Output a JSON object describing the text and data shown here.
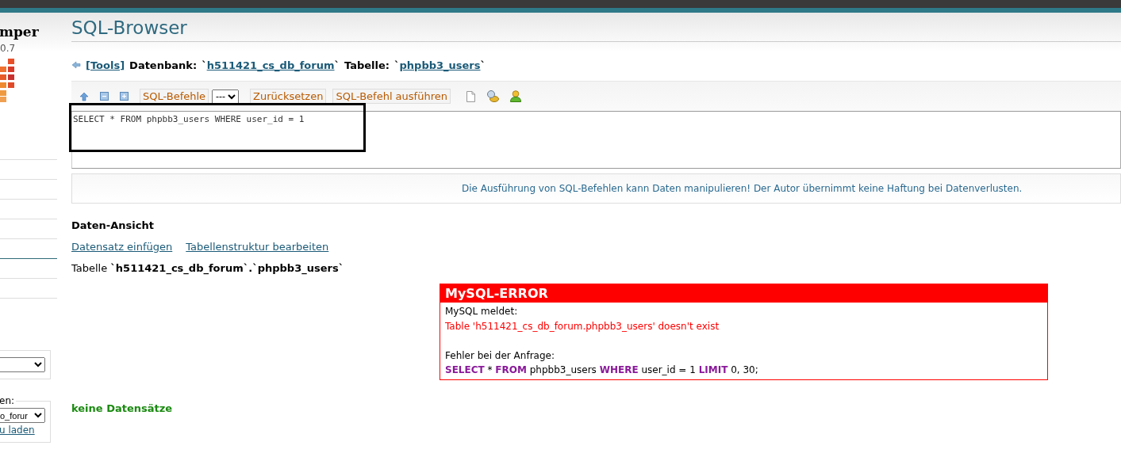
{
  "sidebar": {
    "logo_text": "mper",
    "version": "0.7",
    "fieldsets": [
      {
        "kind": "plain"
      },
      {
        "kind": "labeled",
        "legend": "en:",
        "select": "o_forur",
        "link": "u laden"
      }
    ]
  },
  "header": {
    "title": "SQL-Browser"
  },
  "breadcrumb": {
    "back": "[Tools]",
    "db_label": "Datenbank:",
    "db_open": "`",
    "db_name": "h511421_cs_db_forum",
    "db_close": "`",
    "table_label": "Tabelle:",
    "table_open": "`",
    "table_name": "phpbb3_users",
    "table_close": "`"
  },
  "toolbar": {
    "commands_label": "SQL-Befehle",
    "select": "---",
    "reset": "Zurücksetzen",
    "execute": "SQL-Befehl ausführen"
  },
  "editor": {
    "value": "SELECT * FROM phpbb3_users WHERE user_id = 1"
  },
  "notice": "Die Ausführung von SQL-Befehlen kann Daten manipulieren! Der Autor übernimmt keine Haftung bei Datenverlusten.",
  "data_view": {
    "heading": "Daten-Ansicht",
    "links": [
      "Datensatz einfügen",
      "Tabellenstruktur bearbeiten"
    ],
    "table_caption": "Tabelle **`h511421_cs_db_forum`.`phpbb3_users`**"
  },
  "error": {
    "title": "MySQL-ERROR",
    "reporter": "MySQL meldet:",
    "message": "Table 'h511421_cs_db_forum.phpbb3_users' doesn't exist",
    "query_label": "Fehler bei der Anfrage:",
    "query": [
      {
        "kind": "keyword",
        "text": "SELECT"
      },
      {
        "kind": "plain",
        "text": " * "
      },
      {
        "kind": "keyword",
        "text": "FROM"
      },
      {
        "kind": "plain",
        "text": " phpbb3_users "
      },
      {
        "kind": "keyword",
        "text": "WHERE"
      },
      {
        "kind": "plain",
        "text": " user_id = 1 "
      },
      {
        "kind": "keyword",
        "text": "LIMIT"
      },
      {
        "kind": "plain",
        "text": " 0, 30;"
      }
    ]
  },
  "empty_message": "keine Datensätze"
}
